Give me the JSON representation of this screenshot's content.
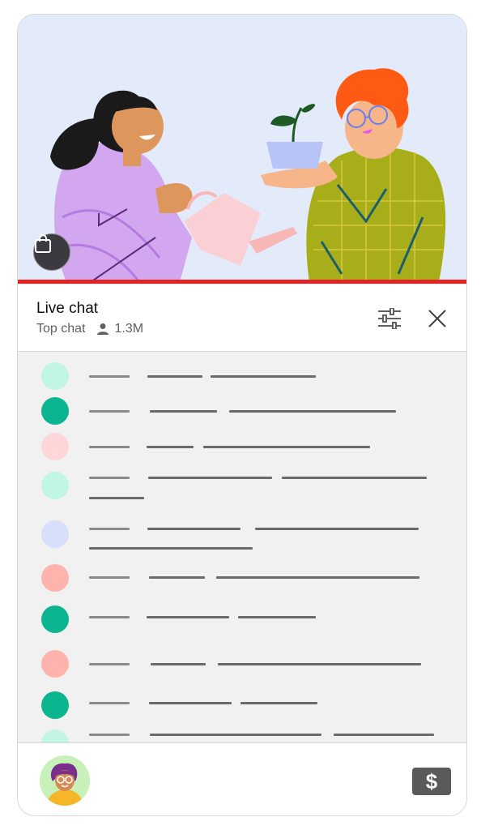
{
  "header": {
    "title": "Live chat",
    "mode": "Top chat",
    "viewers": "1.3M"
  },
  "icons": {
    "shop": "shopping-bag-icon",
    "filter": "sliders-icon",
    "close": "close-icon",
    "viewers": "person-icon",
    "tip": "dollar-icon"
  },
  "footer": {
    "tip_symbol": "$"
  },
  "colors": {
    "progress": "#e02323",
    "video_bg": "#e3ebfb",
    "chat_bg": "#f1f1f1"
  },
  "messages": [
    {
      "avatar_color": "#c1f5e4"
    },
    {
      "avatar_color": "#0bb58f"
    },
    {
      "avatar_color": "#ffd7d9"
    },
    {
      "avatar_color": "#c1f5e4"
    },
    {
      "avatar_color": "#d7dffb"
    },
    {
      "avatar_color": "#ffb3ad"
    },
    {
      "avatar_color": "#0bb58f"
    },
    {
      "avatar_color": "#ffb3ad"
    },
    {
      "avatar_color": "#0bb58f"
    },
    {
      "avatar_color": "#c1f5e4"
    }
  ]
}
